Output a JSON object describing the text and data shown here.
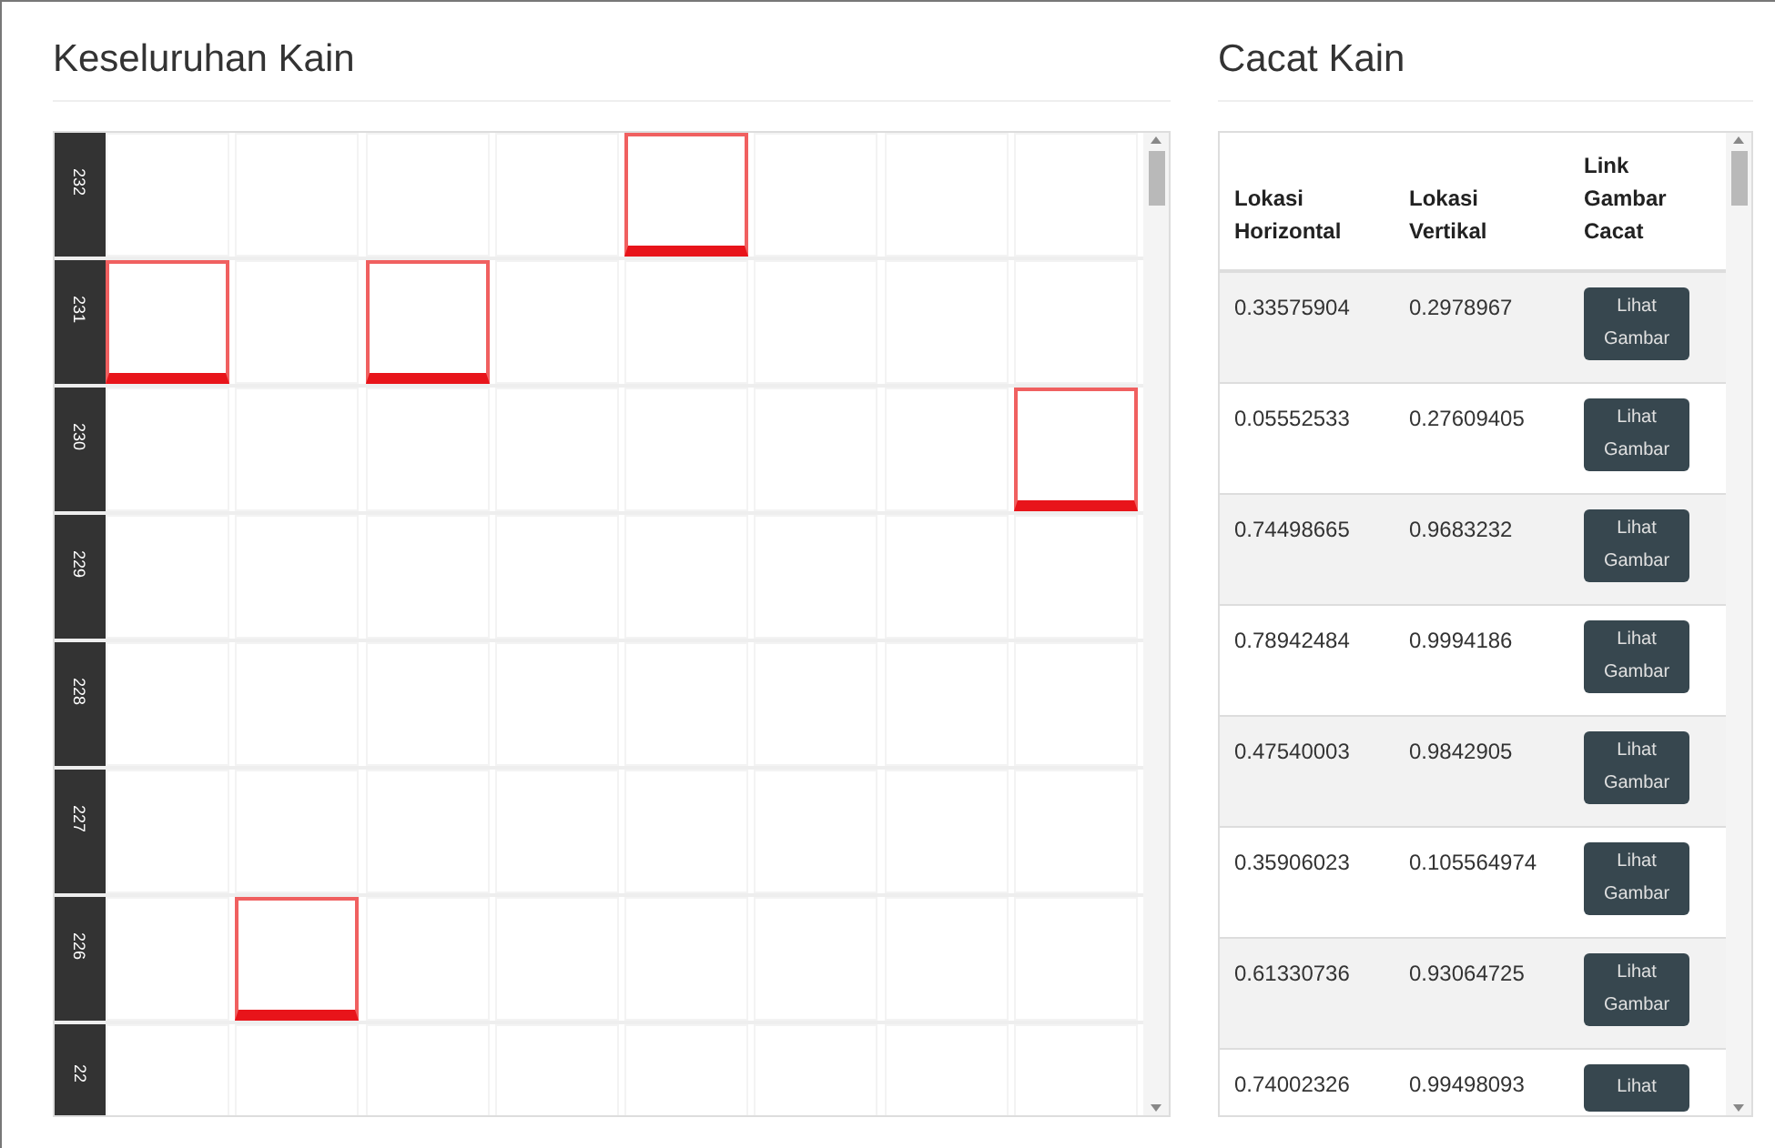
{
  "fabric": {
    "title": "Keseluruhan Kain",
    "rows": [
      {
        "label": "232",
        "cells": [
          false,
          false,
          false,
          false,
          true,
          false,
          false,
          false
        ]
      },
      {
        "label": "231",
        "cells": [
          true,
          false,
          true,
          false,
          false,
          false,
          false,
          false
        ]
      },
      {
        "label": "230",
        "cells": [
          false,
          false,
          false,
          false,
          false,
          false,
          false,
          true
        ]
      },
      {
        "label": "229",
        "cells": [
          false,
          false,
          false,
          false,
          false,
          false,
          false,
          false
        ]
      },
      {
        "label": "228",
        "cells": [
          false,
          false,
          false,
          false,
          false,
          false,
          false,
          false
        ]
      },
      {
        "label": "227",
        "cells": [
          false,
          false,
          false,
          false,
          false,
          false,
          false,
          false
        ]
      },
      {
        "label": "226",
        "cells": [
          false,
          true,
          false,
          false,
          false,
          false,
          false,
          false
        ]
      },
      {
        "label": "22",
        "cells": [
          false,
          false,
          false,
          false,
          false,
          false,
          false,
          false
        ]
      }
    ]
  },
  "defects": {
    "title": "Cacat Kain",
    "columns": [
      "Lokasi Horizontal",
      "Lokasi Vertikal",
      "Link Gambar Cacat"
    ],
    "rows": [
      {
        "horizontal": "0.33575904",
        "vertical": "0.2978967",
        "button": "Lihat Gambar"
      },
      {
        "horizontal": "0.05552533",
        "vertical": "0.27609405",
        "button": "Lihat Gambar"
      },
      {
        "horizontal": "0.74498665",
        "vertical": "0.9683232",
        "button": "Lihat Gambar"
      },
      {
        "horizontal": "0.78942484",
        "vertical": "0.9994186",
        "button": "Lihat Gambar"
      },
      {
        "horizontal": "0.47540003",
        "vertical": "0.9842905",
        "button": "Lihat Gambar"
      },
      {
        "horizontal": "0.35906023",
        "vertical": "0.105564974",
        "button": "Lihat Gambar"
      },
      {
        "horizontal": "0.61330736",
        "vertical": "0.93064725",
        "button": "Lihat Gambar"
      },
      {
        "horizontal": "0.74002326",
        "vertical": "0.99498093",
        "button": "Lihat"
      }
    ]
  }
}
